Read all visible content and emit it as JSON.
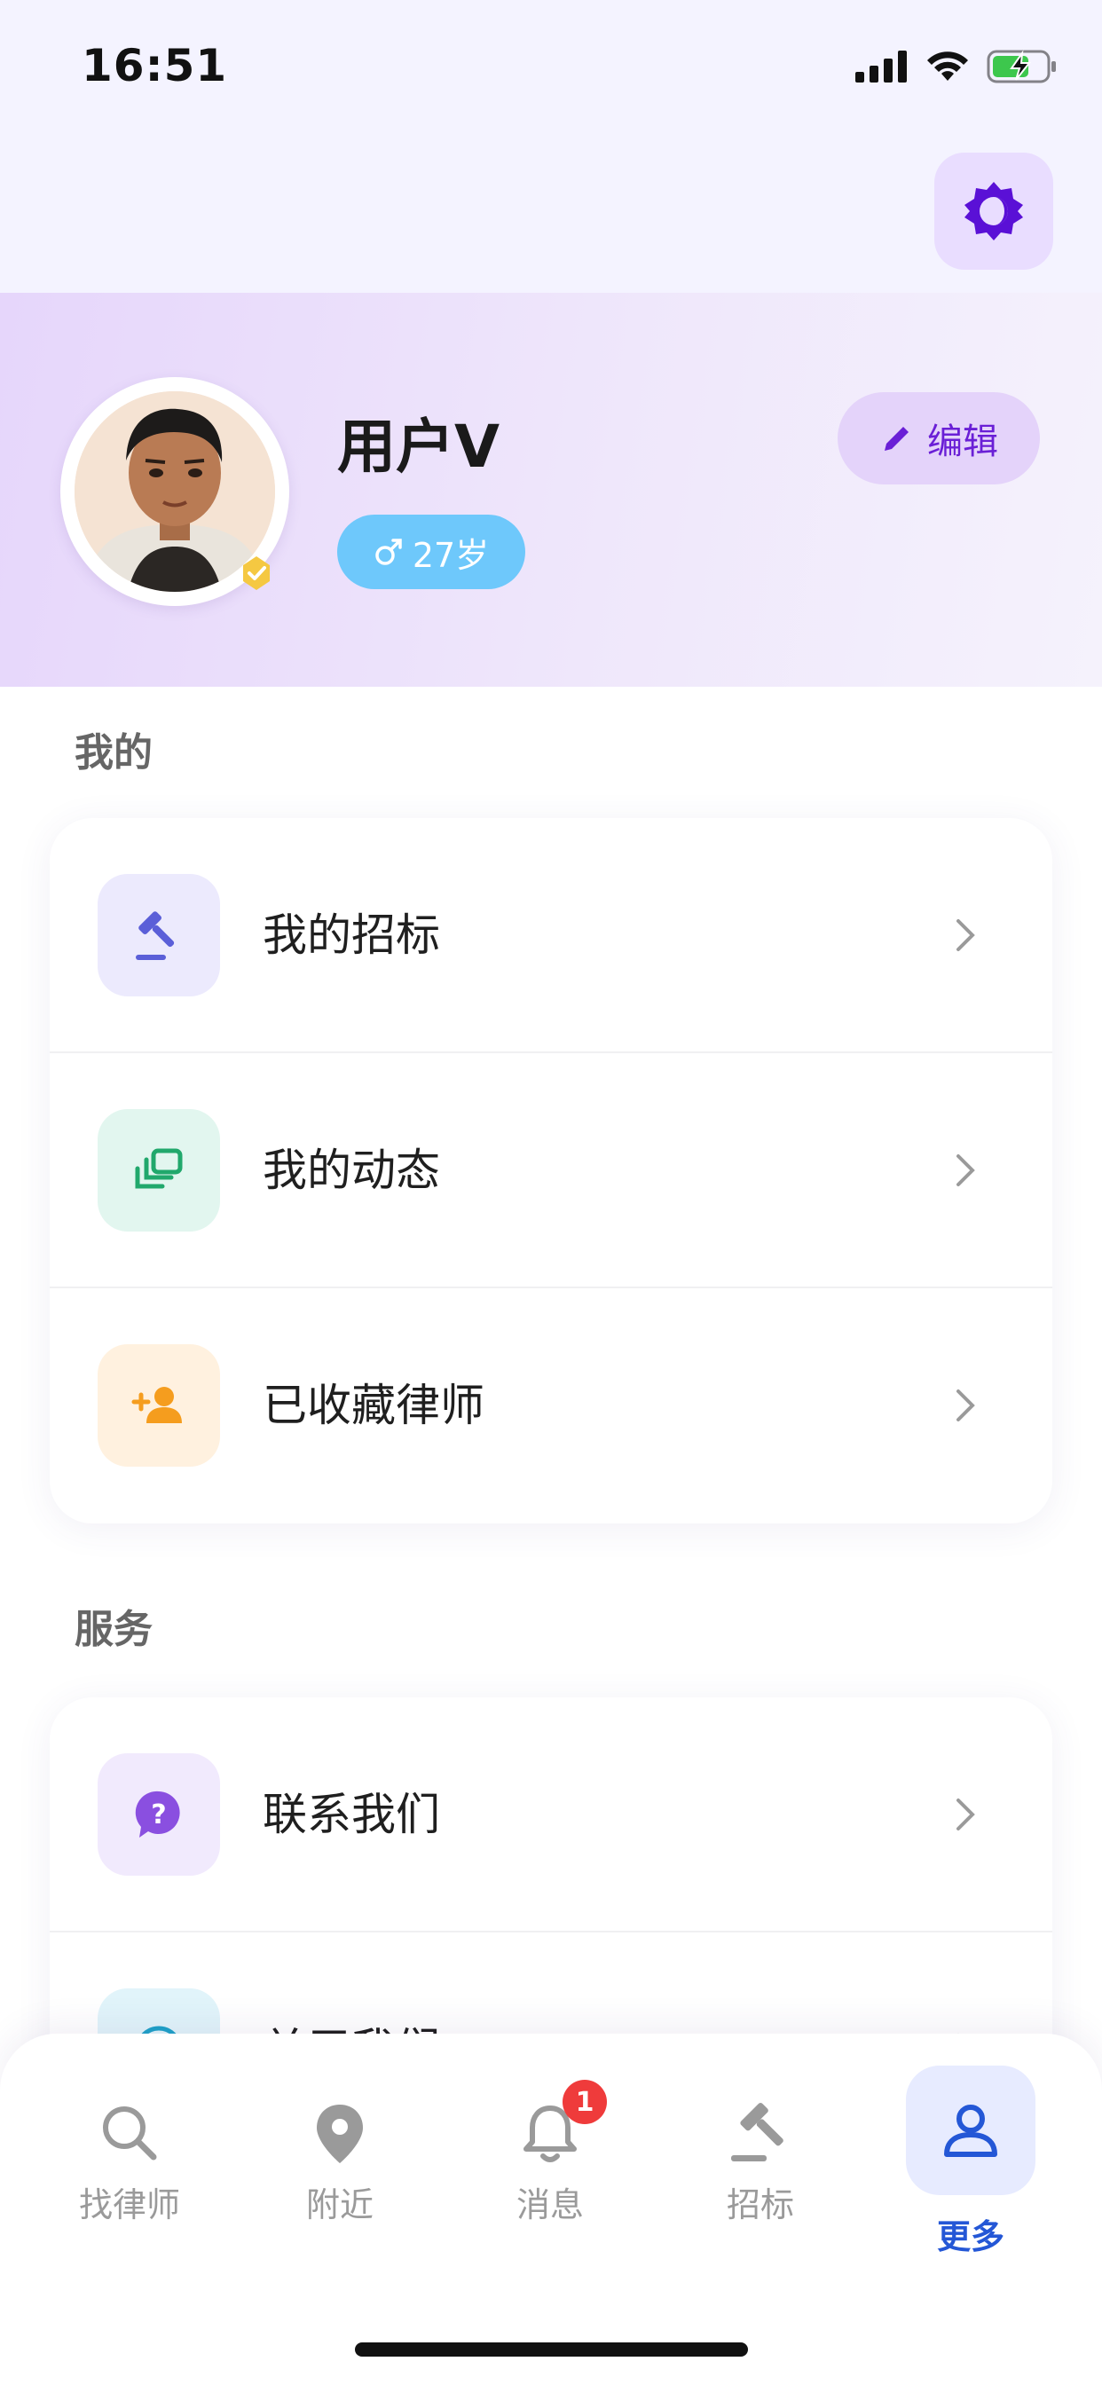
{
  "status_bar": {
    "time": "16:51"
  },
  "profile": {
    "username": "用户V",
    "age": "27岁",
    "edit_label": "编辑"
  },
  "sections": [
    {
      "title": "我的",
      "items": [
        {
          "label": "我的招标",
          "icon": "gavel-icon"
        },
        {
          "label": "我的动态",
          "icon": "layers-icon"
        },
        {
          "label": "已收藏律师",
          "icon": "person-add-icon"
        }
      ]
    },
    {
      "title": "服务",
      "items": [
        {
          "label": "联系我们",
          "icon": "help-chat-icon"
        },
        {
          "label": "关于我们",
          "icon": "info-icon"
        }
      ]
    }
  ],
  "tabbar": {
    "tabs": [
      {
        "label": "找律师",
        "icon": "search-icon"
      },
      {
        "label": "附近",
        "icon": "location-pin-icon"
      },
      {
        "label": "消息",
        "icon": "bell-icon",
        "badge": "1"
      },
      {
        "label": "招标",
        "icon": "gavel-icon"
      },
      {
        "label": "更多",
        "icon": "person-icon",
        "active": true
      }
    ]
  },
  "colors": {
    "accent": "#2457d6",
    "purple": "#6a1fd6",
    "age_badge": "#6ec8fb",
    "notification_badge": "#ef3b3b"
  }
}
